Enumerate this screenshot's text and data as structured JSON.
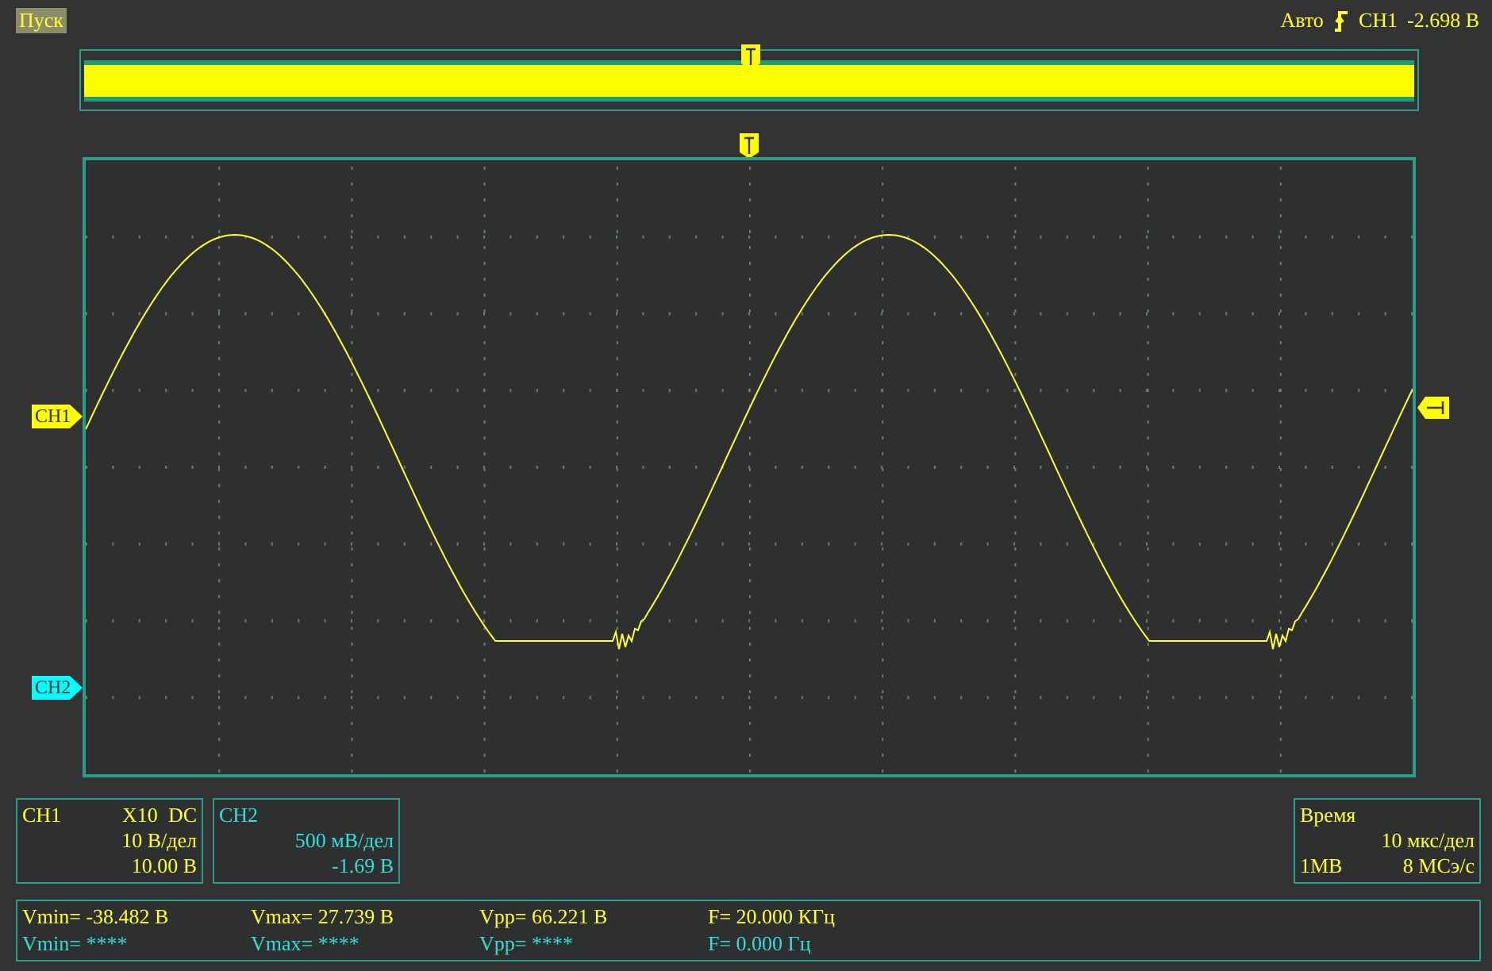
{
  "top_bar": {
    "run_button": "Пуск",
    "trigger_mode": "Авто",
    "trigger_source": "CH1",
    "trigger_level": "-2.698 В"
  },
  "channel_markers": [
    {
      "label": "CH1",
      "color": "#ffff00"
    },
    {
      "label": "CH2",
      "color": "#00ffff"
    }
  ],
  "channels": [
    {
      "name": "CH1",
      "probe": "X10",
      "coupling": "DC",
      "scale": "10 В/дел",
      "offset": "10.00 В",
      "color": "#ffff33"
    },
    {
      "name": "CH2",
      "scale": "500 мВ/дел",
      "offset": "-1.69 В",
      "color": "#33dddd"
    }
  ],
  "timebase": {
    "title": "Время",
    "scale": "10 мкс/дел",
    "memory": "1MB",
    "sample_rate": "8 МСэ/с"
  },
  "measurements": [
    {
      "color": "#ffff33",
      "items": [
        "Vmin= -38.482 В",
        "Vmax= 27.739 В",
        "Vpp= 66.221 В",
        "F= 20.000 КГц"
      ]
    },
    {
      "color": "#33dddd",
      "items": [
        "Vmin= ****",
        "Vmax= ****",
        "Vpp= ****",
        "F= 0.000 Гц"
      ]
    }
  ]
}
